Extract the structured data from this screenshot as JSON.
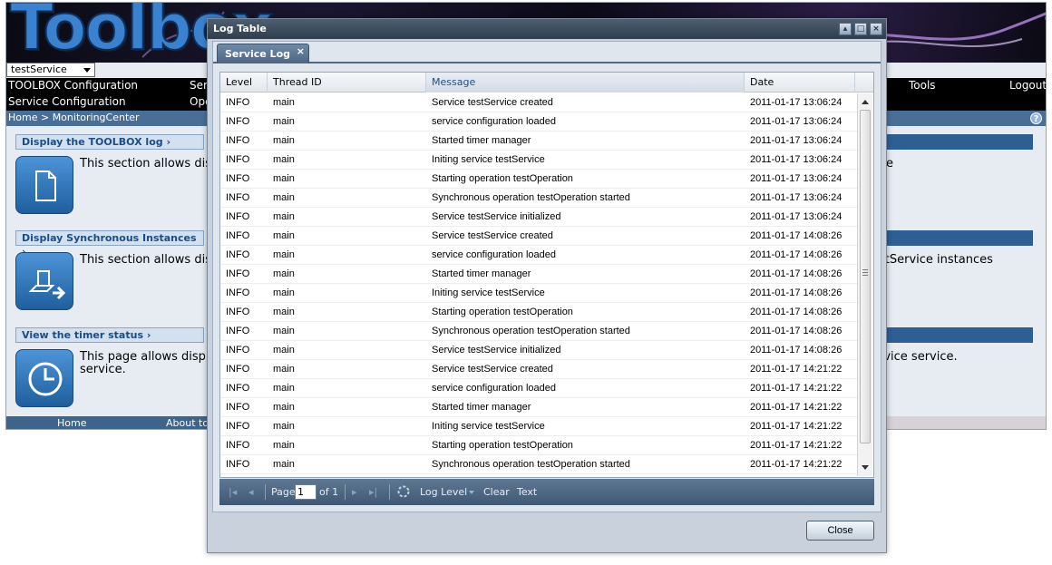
{
  "background_app": {
    "logo_text": "Toolbox",
    "service_select": "testService",
    "menu_row1": [
      "TOOLBOX Configuration",
      "Ser",
      "Tools",
      "Logout"
    ],
    "menu_row2": [
      "Service Configuration",
      "Ope"
    ],
    "breadcrumb": "Home > MonitoringCenter",
    "sections": [
      {
        "link": "Display the TOOLBOX log ›",
        "text_left": "This section allows dis",
        "text_right": "e"
      },
      {
        "link": "Display Synchronous Instances ›",
        "text_left": "This section allows dis",
        "text_right": "stService instances"
      },
      {
        "link": "View the timer status ›",
        "text_left": "This page allows displ",
        "text_left2": "service.",
        "text_right": "rvice service."
      }
    ],
    "footer": [
      "Home",
      "About to"
    ]
  },
  "log_window": {
    "title": "Log Table",
    "tab_label": "Service Log",
    "tab_close": "×",
    "columns": [
      "Level",
      "Thread ID",
      "Message",
      "Date"
    ],
    "rows": [
      [
        "INFO",
        "main",
        "Service testService created",
        "2011-01-17 13:06:24"
      ],
      [
        "INFO",
        "main",
        "service configuration loaded",
        "2011-01-17 13:06:24"
      ],
      [
        "INFO",
        "main",
        "Started timer manager",
        "2011-01-17 13:06:24"
      ],
      [
        "INFO",
        "main",
        "Initing service testService",
        "2011-01-17 13:06:24"
      ],
      [
        "INFO",
        "main",
        "Starting operation testOperation",
        "2011-01-17 13:06:24"
      ],
      [
        "INFO",
        "main",
        "Synchronous operation testOperation started",
        "2011-01-17 13:06:24"
      ],
      [
        "INFO",
        "main",
        "Service testService initialized",
        "2011-01-17 13:06:24"
      ],
      [
        "INFO",
        "main",
        "Service testService created",
        "2011-01-17 14:08:26"
      ],
      [
        "INFO",
        "main",
        "service configuration loaded",
        "2011-01-17 14:08:26"
      ],
      [
        "INFO",
        "main",
        "Started timer manager",
        "2011-01-17 14:08:26"
      ],
      [
        "INFO",
        "main",
        "Initing service testService",
        "2011-01-17 14:08:26"
      ],
      [
        "INFO",
        "main",
        "Starting operation testOperation",
        "2011-01-17 14:08:26"
      ],
      [
        "INFO",
        "main",
        "Synchronous operation testOperation started",
        "2011-01-17 14:08:26"
      ],
      [
        "INFO",
        "main",
        "Service testService initialized",
        "2011-01-17 14:08:26"
      ],
      [
        "INFO",
        "main",
        "Service testService created",
        "2011-01-17 14:21:22"
      ],
      [
        "INFO",
        "main",
        "service configuration loaded",
        "2011-01-17 14:21:22"
      ],
      [
        "INFO",
        "main",
        "Started timer manager",
        "2011-01-17 14:21:22"
      ],
      [
        "INFO",
        "main",
        "Initing service testService",
        "2011-01-17 14:21:22"
      ],
      [
        "INFO",
        "main",
        "Starting operation testOperation",
        "2011-01-17 14:21:22"
      ],
      [
        "INFO",
        "main",
        "Synchronous operation testOperation started",
        "2011-01-17 14:21:22"
      ]
    ],
    "paging": {
      "page_label": "Page",
      "page_value": "1",
      "of_label": "of 1",
      "log_level_label": "Log Level",
      "clear_label": "Clear",
      "text_label": "Text"
    },
    "close_label": "Close"
  }
}
